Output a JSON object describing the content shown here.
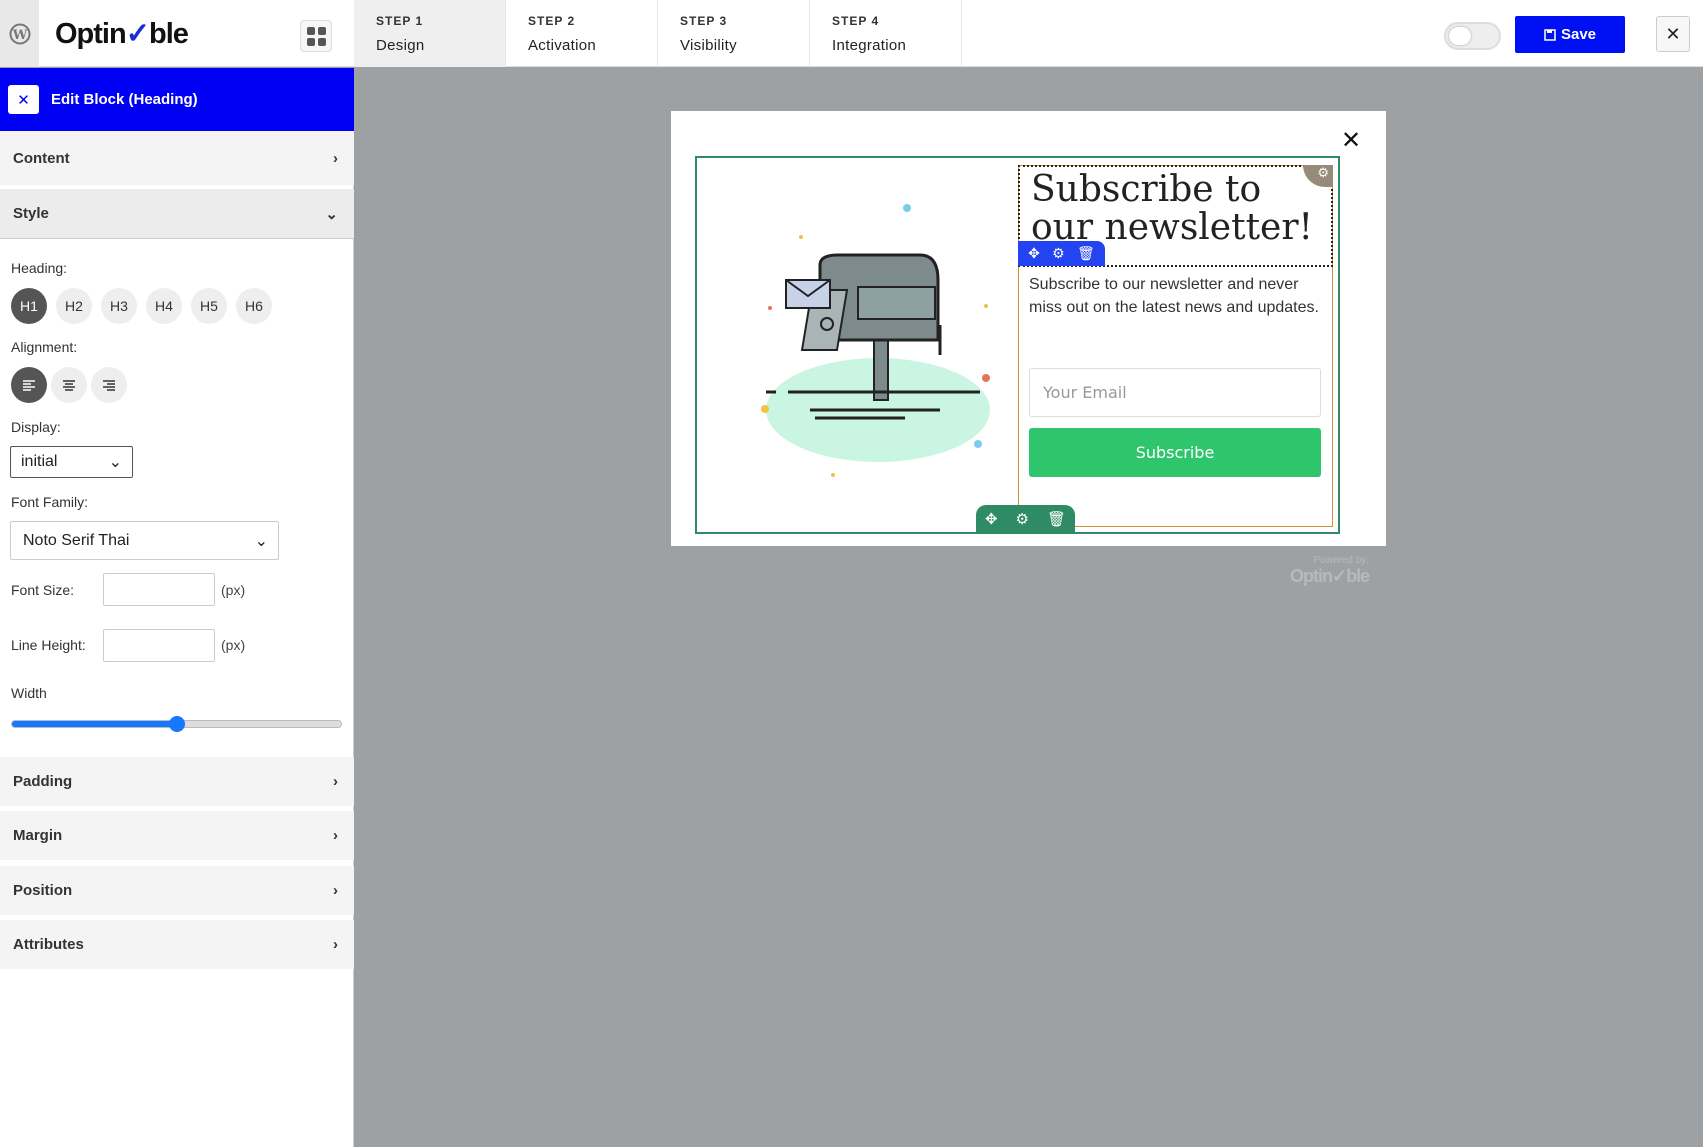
{
  "header": {
    "logo_text": "Optin✓ble",
    "steps": [
      {
        "number": "STEP 1",
        "label": "Design",
        "active": true
      },
      {
        "number": "STEP 2",
        "label": "Activation"
      },
      {
        "number": "STEP 3",
        "label": "Visibility"
      },
      {
        "number": "STEP 4",
        "label": "Integration"
      }
    ],
    "toggle_on": false,
    "save_label": "Save",
    "close_label": "✕"
  },
  "sidebar": {
    "edit_title": "Edit Block (Heading)",
    "close_label": "✕",
    "sections": {
      "content": "Content",
      "style": "Style",
      "padding": "Padding",
      "margin": "Margin",
      "position": "Position",
      "attributes": "Attributes"
    },
    "heading_label": "Heading:",
    "heading_levels": [
      "H1",
      "H2",
      "H3",
      "H4",
      "H5",
      "H6"
    ],
    "heading_selected": "H1",
    "alignment_label": "Alignment:",
    "alignment_selected": "left",
    "display_label": "Display:",
    "display_value": "initial",
    "font_family_label": "Font Family:",
    "font_family_value": "Noto Serif Thai",
    "font_size_label": "Font Size:",
    "font_size_value": "",
    "line_height_label": "Line Height:",
    "line_height_value": "",
    "unit": "(px)",
    "width_label": "Width",
    "width_percent": 50
  },
  "popup": {
    "close_label": "✕",
    "heading": "Subscribe to our newsletter!",
    "description": "Subscribe to our newsletter and never miss out on the latest news and updates.",
    "email_placeholder": "Your Email",
    "button_label": "Subscribe",
    "powered_by": "Powered by:",
    "powered_logo": "Optin✓ble"
  },
  "colors": {
    "accent": "#0000f5",
    "subscribe": "#2ec56c",
    "block_border": "#2e8b63",
    "column_border": "#d0913a"
  }
}
